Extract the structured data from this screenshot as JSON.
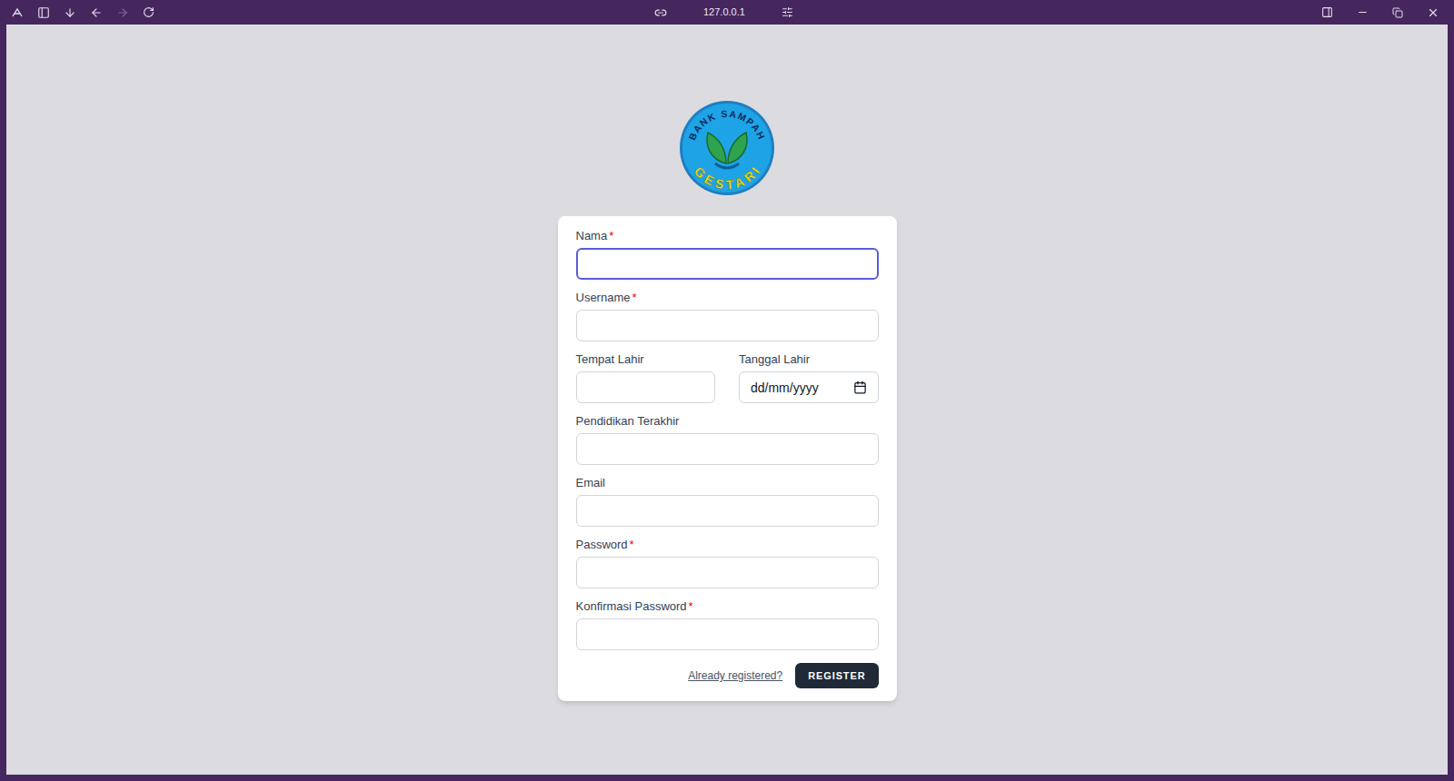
{
  "browser": {
    "address": "127.0.0.1",
    "back_enabled": true,
    "forward_enabled": false
  },
  "logo": {
    "top": "BANK SAMPAH",
    "bottom": "GESTARI"
  },
  "form": {
    "required_mark": "*",
    "rows": [
      [
        {
          "label": "Nama",
          "required": true,
          "focused": true,
          "kind": "text"
        }
      ],
      [
        {
          "label": "Username",
          "required": true,
          "focused": false,
          "kind": "text"
        }
      ],
      [
        {
          "label": "Tempat Lahir",
          "required": false,
          "focused": false,
          "kind": "text"
        },
        {
          "label": "Tanggal Lahir",
          "required": false,
          "focused": false,
          "kind": "date",
          "placeholder": "dd/mm/yyyy"
        }
      ],
      [
        {
          "label": "Pendidikan Terakhir",
          "required": false,
          "focused": false,
          "kind": "text"
        }
      ],
      [
        {
          "label": "Email",
          "required": false,
          "focused": false,
          "kind": "email"
        }
      ],
      [
        {
          "label": "Password",
          "required": true,
          "focused": false,
          "kind": "password"
        }
      ],
      [
        {
          "label": "Konfirmasi Password",
          "required": true,
          "focused": false,
          "kind": "password"
        }
      ]
    ],
    "link": "Already registered?",
    "submit": "REGISTER"
  }
}
